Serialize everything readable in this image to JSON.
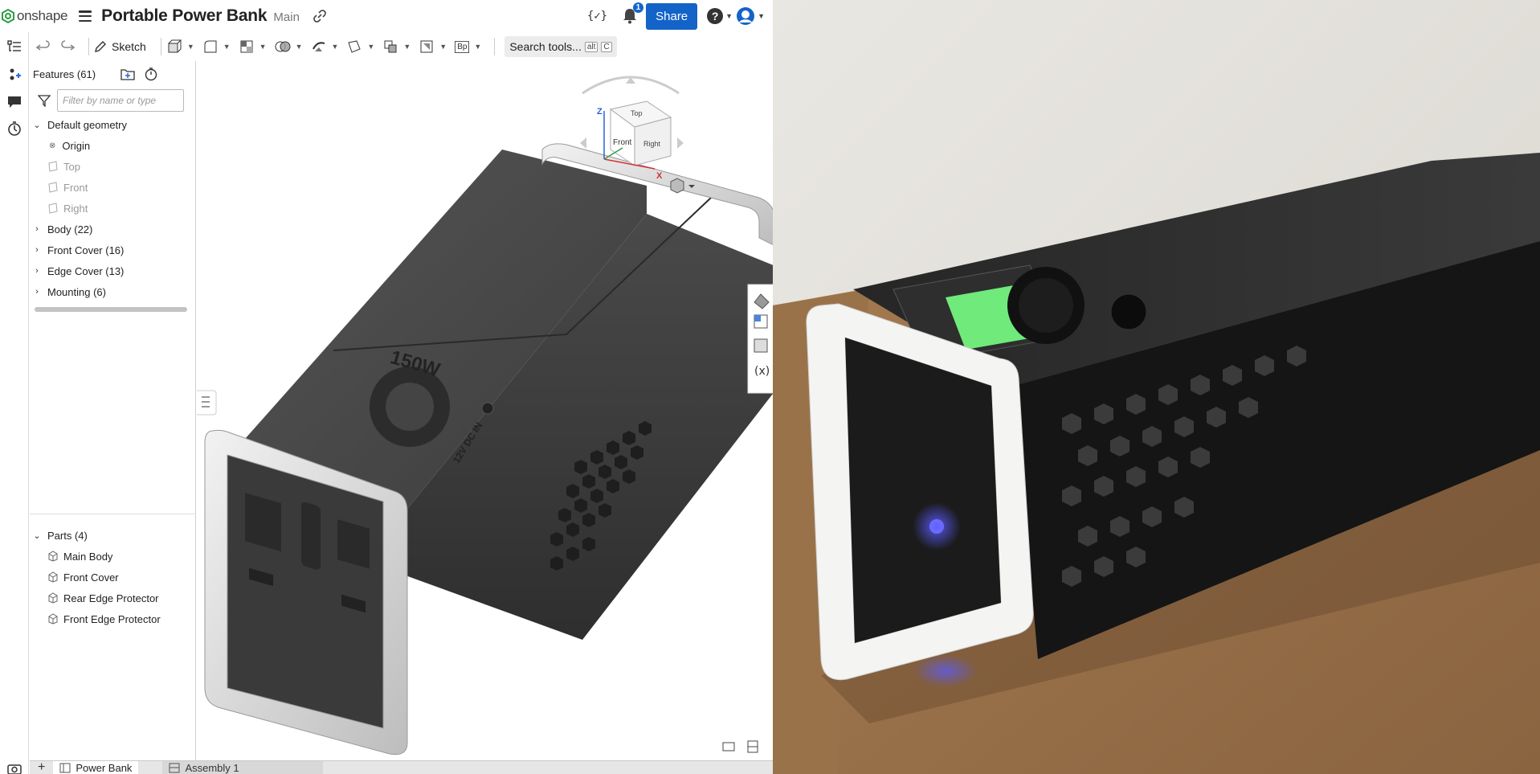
{
  "header": {
    "logo_text": "onshape",
    "doc_title": "Portable Power Bank",
    "branch": "Main",
    "code_label": "{✓}",
    "notification_count": "1",
    "share_label": "Share",
    "help_label": "?"
  },
  "toolbar": {
    "sketch_label": "Sketch",
    "search_label": "Search tools...",
    "shortcut_key1": "alt",
    "shortcut_key2": "C",
    "variable_label": "Bp"
  },
  "features": {
    "title": "Features (61)",
    "filter_placeholder": "Filter by name or type",
    "default_geometry": "Default geometry",
    "origin": "Origin",
    "planes": [
      "Top",
      "Front",
      "Right"
    ],
    "groups": [
      "Body (22)",
      "Front Cover (16)",
      "Edge Cover (13)",
      "Mounting (6)"
    ]
  },
  "parts": {
    "title": "Parts (4)",
    "items": [
      "Main Body",
      "Front Cover",
      "Rear Edge Protector",
      "Front Edge Protector"
    ]
  },
  "view_cube": {
    "top": "Top",
    "front": "Front",
    "right": "Right",
    "z": "Z",
    "x": "X"
  },
  "model_labels": {
    "wattage": "150W",
    "dc_in": "12V DC IN"
  },
  "tabs": {
    "active": "Power Bank",
    "other": "Assembly 1"
  },
  "colors": {
    "accent": "#1363c8",
    "logo_green": "#2e9e44",
    "model_dark": "#3a3a3a",
    "edge_light": "#e4e4e4"
  }
}
